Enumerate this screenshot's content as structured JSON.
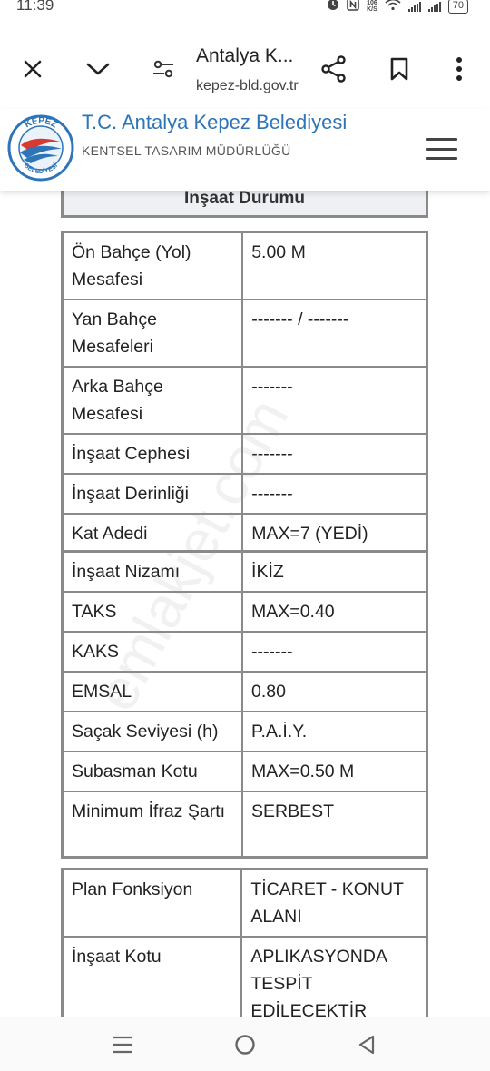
{
  "status": {
    "time": "11:39",
    "battery": "70",
    "network_speed": "106",
    "network_unit": "K/S"
  },
  "browser": {
    "tab_title": "Antalya K...",
    "url": "kepez-bld.gov.tr",
    "icons": [
      "close-icon",
      "chevron-down-icon",
      "page-settings-icon",
      "share-icon",
      "bookmark-icon",
      "more-vert-icon"
    ]
  },
  "site": {
    "name": "T.C. Antalya Kepez Belediyesi",
    "subtitle": "KENTSEL TASARIM MÜDÜRLÜĞÜ",
    "logo_top": "KEPEZ",
    "logo_bottom": "BELEDİYESİ",
    "brand_color": "#2d74b8",
    "logo_red": "#d83a32"
  },
  "section_title": "İnşaat Durumu",
  "table1": [
    {
      "label": "Ön Bahçe (Yol) Mesafesi",
      "value": "5.00 M"
    },
    {
      "label": "Yan Bahçe Mesafeleri",
      "value": "------- / -------"
    },
    {
      "label": "Arka Bahçe Mesafesi",
      "value": "-------"
    },
    {
      "label": "İnşaat Cephesi",
      "value": "-------"
    },
    {
      "label": "İnşaat Derinliği",
      "value": "-------"
    },
    {
      "label": "Kat Adedi",
      "value": "MAX=7 (YEDİ)"
    }
  ],
  "table2": [
    {
      "label": "İnşaat Nizamı",
      "value": "İKİZ"
    },
    {
      "label": "TAKS",
      "value": "MAX=0.40"
    },
    {
      "label": "KAKS",
      "value": "-------"
    },
    {
      "label": "EMSAL",
      "value": "0.80"
    },
    {
      "label": "Saçak Seviyesi (h)",
      "value": "P.A.İ.Y."
    },
    {
      "label": "Subasman Kotu",
      "value": "MAX=0.50 M"
    },
    {
      "label": "Minimum İfraz Şartı",
      "value": "SERBEST"
    }
  ],
  "table3": [
    {
      "label": "Plan Fonksiyon",
      "value": "TİCARET - KONUT ALANI"
    },
    {
      "label": "İnşaat Kotu",
      "value": "APLIKASYONDA TESPİT EDİLECEKTİR"
    }
  ],
  "watermark": "emlakjet.com",
  "navbar": {
    "icons": [
      "recent-apps-icon",
      "home-icon",
      "back-icon"
    ]
  }
}
